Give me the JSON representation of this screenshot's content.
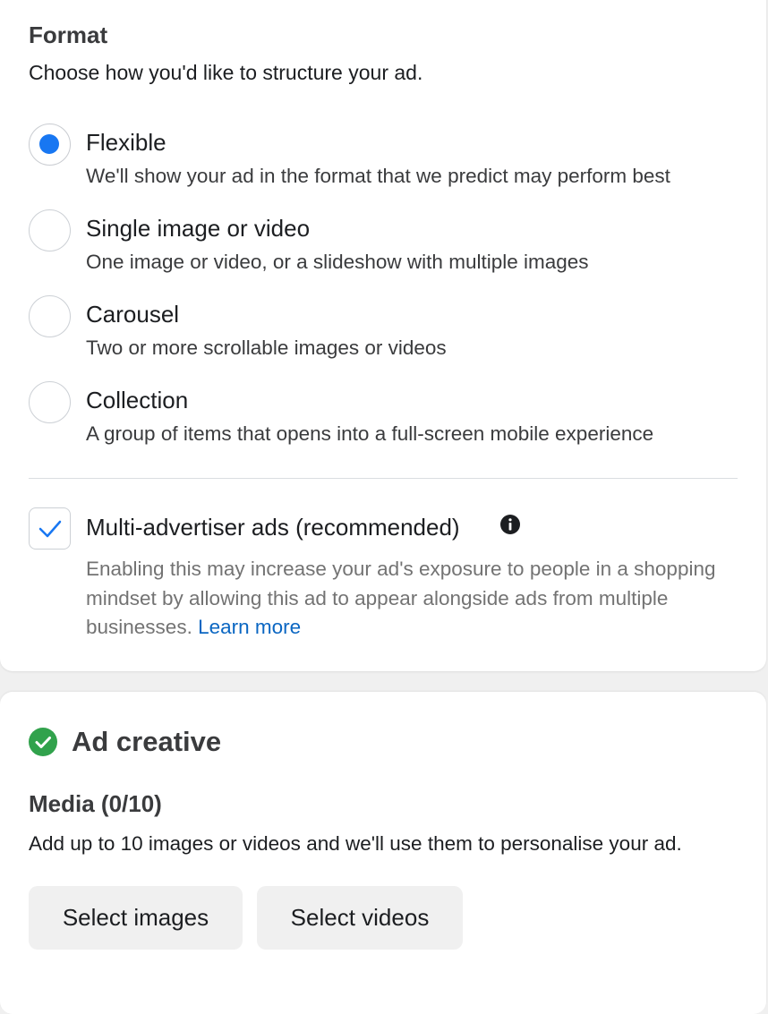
{
  "format": {
    "title": "Format",
    "subtitle": "Choose how you'd like to structure your ad.",
    "options": [
      {
        "label": "Flexible",
        "description": "We'll show your ad in the format that we predict may perform best",
        "selected": true
      },
      {
        "label": "Single image or video",
        "description": "One image or video, or a slideshow with multiple images",
        "selected": false
      },
      {
        "label": "Carousel",
        "description": "Two or more scrollable images or videos",
        "selected": false
      },
      {
        "label": "Collection",
        "description": "A group of items that opens into a full-screen mobile experience",
        "selected": false
      }
    ],
    "multi_advertiser": {
      "label": "Multi-advertiser ads (recommended)",
      "checked": true,
      "description": "Enabling this may increase your ad's exposure to people in a shopping mindset by allowing this ad to appear alongside ads from multiple businesses.",
      "learn_more": "Learn more",
      "info_icon": "info-icon"
    }
  },
  "ad_creative": {
    "title": "Ad creative",
    "status_icon": "green-check-icon",
    "media_title": "Media (0/10)",
    "media_subtitle": "Add up to 10 images or videos and we'll use them to personalise your ad.",
    "buttons": {
      "select_images": "Select images",
      "select_videos": "Select videos"
    }
  },
  "colors": {
    "accent": "#1877f2",
    "link": "#0a66c2",
    "success": "#31a24c",
    "muted_text": "#737373"
  }
}
